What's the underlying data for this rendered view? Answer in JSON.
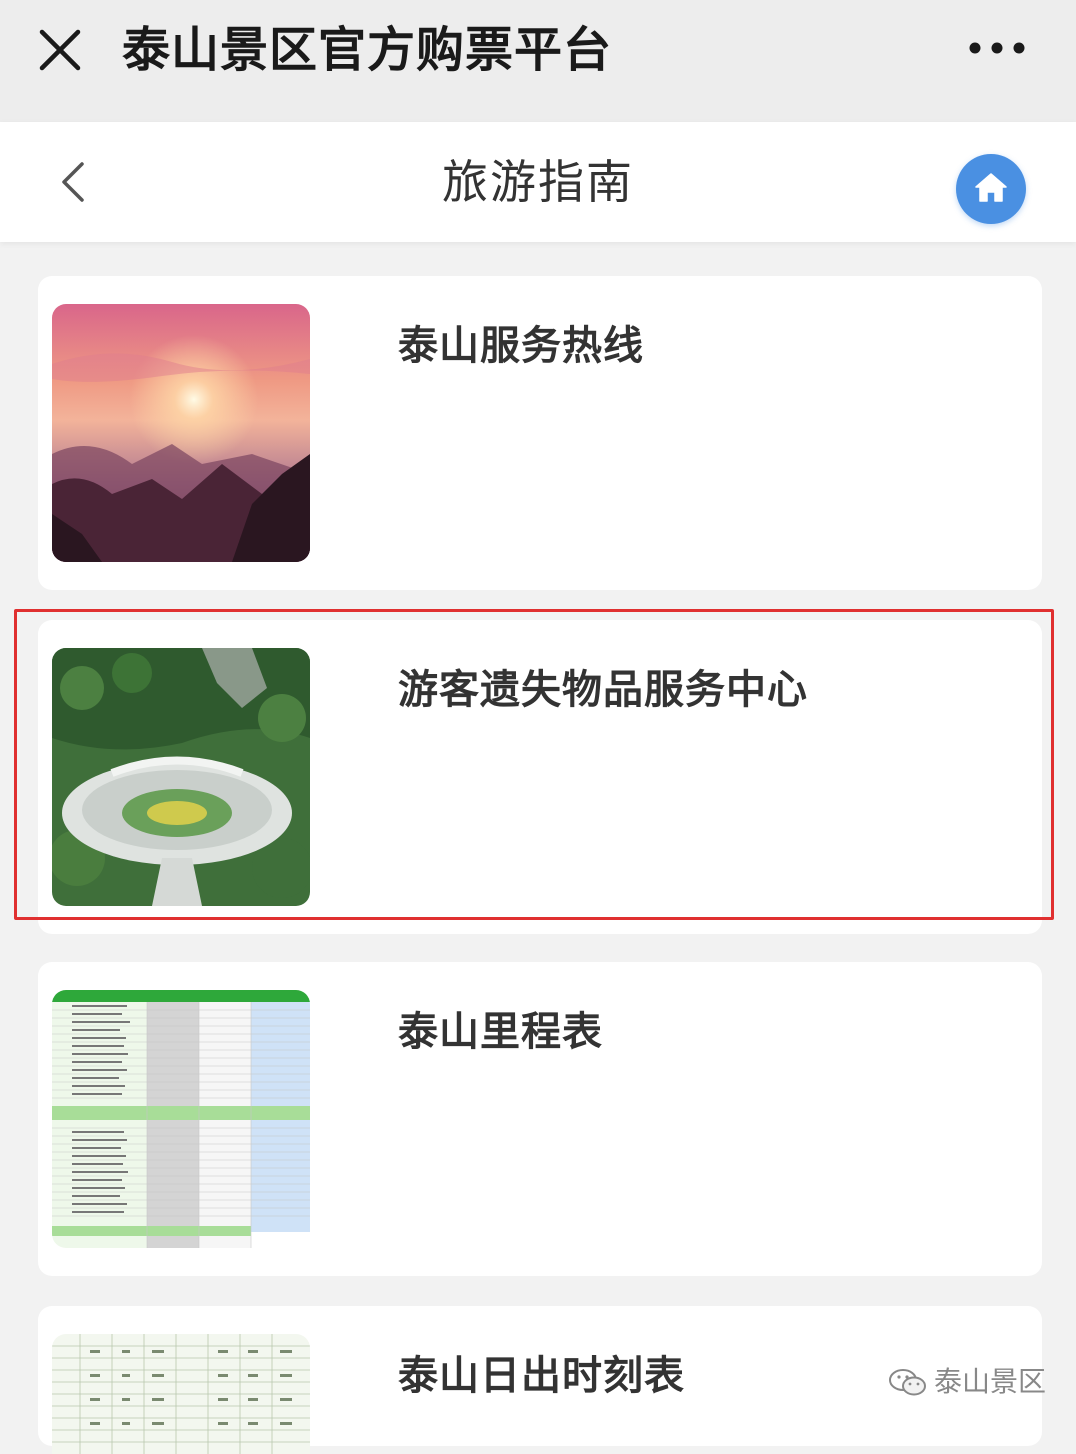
{
  "window": {
    "title": "泰山景区官方购票平台",
    "close_icon": "close-icon",
    "more_icon": "more-icon"
  },
  "navbar": {
    "title": "旅游指南",
    "back_icon": "chevron-left-icon",
    "home_icon": "home-icon",
    "home_color": "#4a90e2"
  },
  "cards": [
    {
      "title": "泰山服务热线",
      "image": "sunrise-sea-of-clouds-photo"
    },
    {
      "title": "游客遗失物品服务中心",
      "image": "service-center-aerial-photo"
    },
    {
      "title": "泰山里程表",
      "image": "mileage-table-image"
    },
    {
      "title": "泰山日出时刻表",
      "image": "sunrise-timetable-image"
    }
  ],
  "highlight_color": "#e03030",
  "watermark": {
    "text": "泰山景区",
    "icon": "wechat-icon"
  }
}
